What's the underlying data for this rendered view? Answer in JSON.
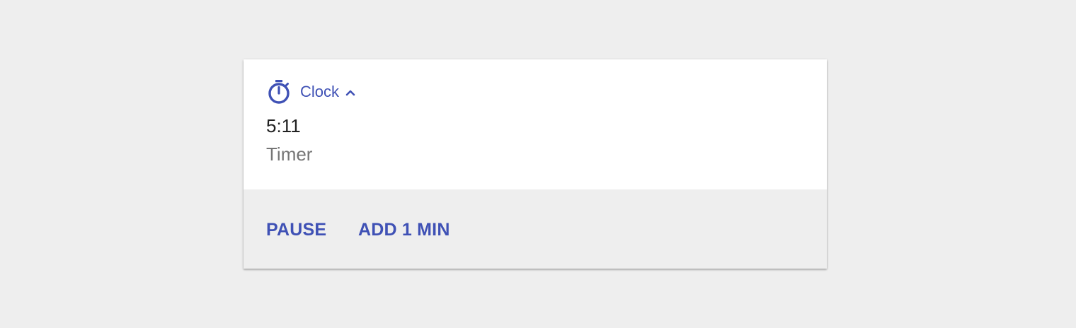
{
  "notification": {
    "app_name": "Clock",
    "app_icon": "stopwatch-icon",
    "expand_icon": "chevron-up-icon",
    "title": "5:11",
    "subtitle": "Timer",
    "actions": [
      {
        "label": "PAUSE"
      },
      {
        "label": "ADD 1 MIN"
      }
    ]
  },
  "colors": {
    "accent": "#3f51b5",
    "background": "#eeeeee",
    "card": "#ffffff",
    "title_text": "#212121",
    "subtitle_text": "#757575"
  }
}
